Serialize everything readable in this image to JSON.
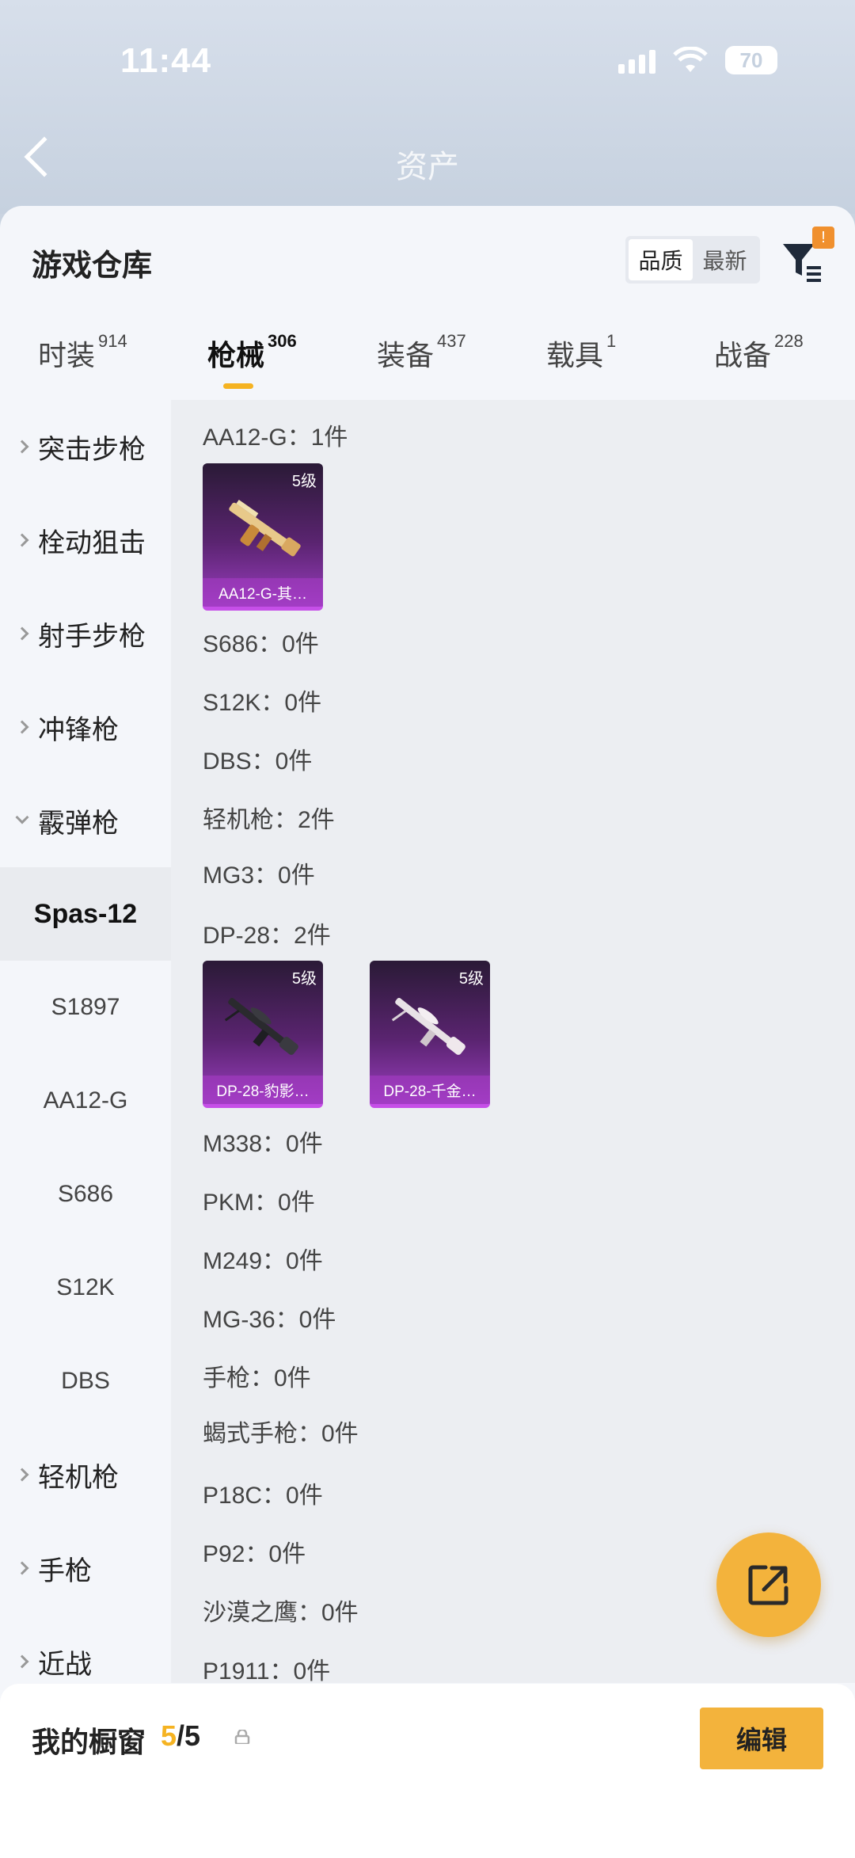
{
  "status": {
    "time": "11:44",
    "battery": "70"
  },
  "background": {
    "title": "资产"
  },
  "header": {
    "title": "游戏仓库",
    "sort_options": [
      "品质",
      "最新"
    ],
    "filter_badge": "!"
  },
  "tabs": [
    {
      "label": "时装",
      "count": "914"
    },
    {
      "label": "枪械",
      "count": "306"
    },
    {
      "label": "装备",
      "count": "437"
    },
    {
      "label": "载具",
      "count": "1"
    },
    {
      "label": "战备",
      "count": "228"
    }
  ],
  "sidebar": {
    "categories": [
      "突击步枪",
      "栓动狙击",
      "射手步枪",
      "冲锋枪",
      "霰弹枪"
    ],
    "sub_items": [
      "Spas-12",
      "S1897",
      "AA12-G",
      "S686",
      "S12K",
      "DBS"
    ],
    "more_categories": [
      "轻机枪",
      "手枪",
      "近战"
    ]
  },
  "content": {
    "rows": [
      "AA12-G：1件",
      "S686：0件",
      "S12K：0件",
      "DBS：0件",
      "轻机枪：2件",
      "MG3：0件",
      "DP-28：2件",
      "M338：0件",
      "PKM：0件",
      "M249：0件",
      "MG-36：0件",
      "手枪：0件",
      "蝎式手枪：0件",
      "P18C：0件",
      "P92：0件",
      "沙漠之鹰：0件",
      "P1911：0件"
    ],
    "cards": [
      {
        "level": "5级",
        "name": "AA12-G-其…",
        "color": "#7b2c9a"
      },
      {
        "level": "5级",
        "name": "DP-28-豹影…",
        "color": "#7b2c9a"
      },
      {
        "level": "5级",
        "name": "DP-28-千金…",
        "color": "#7b2c9a"
      }
    ]
  },
  "footer": {
    "showcase_label": "我的橱窗",
    "showcase_current": "5",
    "showcase_total": "/5",
    "edit_label": "编辑"
  },
  "colors": {
    "accent": "#f5b322",
    "card_purple": "#9a3dbf",
    "badge": "#f0902e"
  }
}
